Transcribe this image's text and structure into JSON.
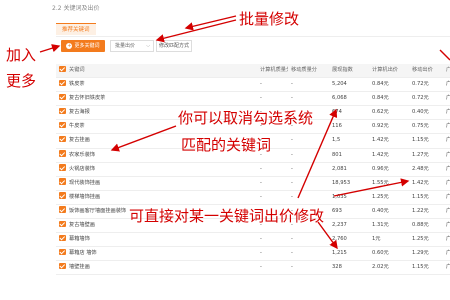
{
  "section_title": "2.2 关键词及出价",
  "tab_label": "推荐关键词",
  "toolbar": {
    "add_label": "更多关键词",
    "batch_select": "批量出价",
    "match_label": "修改匹配方式"
  },
  "table": {
    "headers": {
      "keyword": "关键词",
      "m1": "计算机质量分",
      "m2": "移动质量分",
      "heat": "展现指数",
      "bid": "计算机出价",
      "bid2": "移动出价",
      "more": "广"
    },
    "rows": [
      {
        "kw": "铁皮茶",
        "m1": "-",
        "m2": "-",
        "heat": "5,204",
        "bid": "0.84元",
        "bid2": "0.72元",
        "more": "广"
      },
      {
        "kw": "复古怀旧铁皮茶",
        "m1": "-",
        "m2": "-",
        "heat": "6,068",
        "bid": "0.84元",
        "bid2": "0.72元",
        "more": "广"
      },
      {
        "kw": "复古海报",
        "m1": "-",
        "m2": "-",
        "heat": "674",
        "bid": "0.62元",
        "bid2": "0.40元",
        "more": "广"
      },
      {
        "kw": "牛皮茶",
        "m1": "-",
        "m2": "-",
        "heat": "116",
        "bid": "0.92元",
        "bid2": "0.75元",
        "more": "广"
      },
      {
        "kw": "复古挂画",
        "m1": "-",
        "m2": "-",
        "heat": "1,5",
        "bid": "1.42元",
        "bid2": "1.15元",
        "more": "广"
      },
      {
        "kw": "农家乐装饰",
        "m1": "-",
        "m2": "-",
        "heat": "801",
        "bid": "1.42元",
        "bid2": "1.27元",
        "more": "广"
      },
      {
        "kw": "火锅店装饰",
        "m1": "-",
        "m2": "-",
        "heat": "2,081",
        "bid": "0.96元",
        "bid2": "2.48元",
        "more": "广"
      },
      {
        "kw": "现代装饰挂画",
        "m1": "-",
        "m2": "-",
        "heat": "18,953",
        "bid": "1.55元",
        "bid2": "1.42元",
        "more": "广"
      },
      {
        "kw": "楼梯墙饰挂画",
        "m1": "-",
        "m2": "-",
        "heat": "1,035",
        "bid": "1.25元",
        "bid2": "1.15元",
        "more": "广"
      },
      {
        "kw": "饭饰画客厅墙面挂画装饰",
        "m1": "-",
        "m2": "-",
        "heat": "693",
        "bid": "0.40元",
        "bid2": "1.22元",
        "more": "广"
      },
      {
        "kw": "复古墙壁画",
        "m1": "-",
        "m2": "-",
        "heat": "2,237",
        "bid": "1.31元",
        "bid2": "0.88元",
        "more": "广"
      },
      {
        "kw": "幕箱墙饰",
        "m1": "-",
        "m2": "-",
        "heat": "2,760",
        "bid": "1元",
        "bid2": "1.25元",
        "more": "广"
      },
      {
        "kw": "幕箱店 墙饰",
        "m1": "-",
        "m2": "-",
        "heat": "1,215",
        "bid": "0.60元",
        "bid2": "1.29元",
        "more": "广"
      },
      {
        "kw": "墙壁挂画",
        "m1": "-",
        "m2": "-",
        "heat": "328",
        "bid": "2.02元",
        "bid2": "1.15元",
        "more": "广"
      }
    ]
  },
  "annotations": {
    "batch_modify": "批量修改",
    "add_more_1": "加入",
    "add_more_2": "更多",
    "cancel_1": "你可以取消勾选系统",
    "cancel_2": "匹配的关键词",
    "bid_modify": "可直接对某一关键词出价修改"
  },
  "colors": {
    "accent": "#f37b1d",
    "annotation": "#d40000"
  }
}
